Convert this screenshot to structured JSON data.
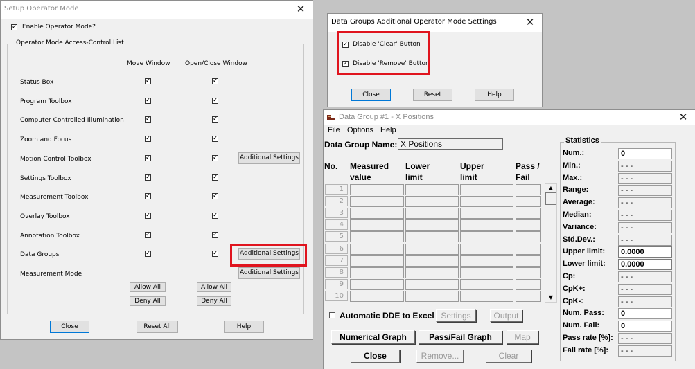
{
  "setup_window": {
    "title": "Setup Operator Mode",
    "enable_label": "Enable Operator Mode?",
    "enable_checked": true,
    "group_label": "Operator Mode Access-Control List",
    "col_move": "Move Window",
    "col_open": "Open/Close Window",
    "rows": [
      {
        "label": "Status Box",
        "move": true,
        "open": true,
        "has_move": true,
        "has_open": true,
        "extra": ""
      },
      {
        "label": "Program Toolbox",
        "move": true,
        "open": true,
        "has_move": true,
        "has_open": true,
        "extra": ""
      },
      {
        "label": "Computer Controlled Illumination",
        "move": true,
        "open": true,
        "has_move": true,
        "has_open": true,
        "extra": ""
      },
      {
        "label": "Zoom and Focus",
        "move": true,
        "open": true,
        "has_move": true,
        "has_open": true,
        "extra": ""
      },
      {
        "label": "Motion Control Toolbox",
        "move": true,
        "open": true,
        "has_move": true,
        "has_open": true,
        "extra": "Additional Settings"
      },
      {
        "label": "Settings Toolbox",
        "move": true,
        "open": true,
        "has_move": true,
        "has_open": true,
        "extra": ""
      },
      {
        "label": "Measurement Toolbox",
        "move": true,
        "open": true,
        "has_move": true,
        "has_open": true,
        "extra": ""
      },
      {
        "label": "Overlay Toolbox",
        "move": true,
        "open": true,
        "has_move": true,
        "has_open": true,
        "extra": ""
      },
      {
        "label": "Annotation Toolbox",
        "move": true,
        "open": true,
        "has_move": true,
        "has_open": true,
        "extra": ""
      },
      {
        "label": "Data Groups",
        "move": true,
        "open": true,
        "has_move": true,
        "has_open": true,
        "extra": "Additional Settings"
      },
      {
        "label": "Measurement Mode",
        "move": false,
        "open": false,
        "has_move": false,
        "has_open": false,
        "extra": "Additional Settings"
      }
    ],
    "allow_all": "Allow All",
    "deny_all": "Deny All",
    "close": "Close",
    "reset_all": "Reset All",
    "help": "Help"
  },
  "dg_settings_window": {
    "title": "Data Groups Additional Operator Mode Settings",
    "disable_clear": "Disable 'Clear' Button",
    "disable_clear_checked": true,
    "disable_remove": "Disable 'Remove' Button",
    "disable_remove_checked": true,
    "close": "Close",
    "reset": "Reset",
    "help": "Help"
  },
  "data_group_window": {
    "title": "Data Group #1 - X Positions",
    "menu": [
      "File",
      "Options",
      "Help"
    ],
    "name_label": "Data Group Name:",
    "name_value": "X Positions",
    "headers": {
      "no": "No.",
      "measured1": "Measured",
      "measured2": "value",
      "lower1": "Lower",
      "lower2": "limit",
      "upper1": "Upper",
      "upper2": "limit",
      "pass1": "Pass /",
      "pass2": "Fail"
    },
    "row_numbers": [
      "1",
      "2",
      "3",
      "4",
      "5",
      "6",
      "7",
      "8",
      "9",
      "10"
    ],
    "dde_label": "Automatic DDE to Excel",
    "dde_checked": false,
    "settings": "Settings",
    "output": "Output",
    "numerical_graph": "Numerical Graph",
    "passfail_graph": "Pass/Fail Graph",
    "map": "Map",
    "close": "Close",
    "remove": "Remove...",
    "clear": "Clear",
    "statistics_label": "Statistics",
    "stats": [
      {
        "label": "Num.:",
        "value": "0",
        "type": "num"
      },
      {
        "label": "Min.:",
        "value": "- - -",
        "type": "ro"
      },
      {
        "label": "Max.:",
        "value": "- - -",
        "type": "ro"
      },
      {
        "label": "Range:",
        "value": "- - -",
        "type": "ro"
      },
      {
        "label": "Average:",
        "value": "- - -",
        "type": "ro"
      },
      {
        "label": "Median:",
        "value": "- - -",
        "type": "ro"
      },
      {
        "label": "Variance:",
        "value": "- - -",
        "type": "ro"
      },
      {
        "label": "Std.Dev.:",
        "value": "- - -",
        "type": "ro"
      },
      {
        "label": "Upper limit:",
        "value": "0.0000",
        "type": "edit"
      },
      {
        "label": "Lower limit:",
        "value": "0.0000",
        "type": "edit"
      },
      {
        "label": "Cp:",
        "value": "- - -",
        "type": "ro"
      },
      {
        "label": "CpK+:",
        "value": "- - -",
        "type": "ro"
      },
      {
        "label": "CpK-:",
        "value": "- - -",
        "type": "ro"
      },
      {
        "label": "Num. Pass:",
        "value": "0",
        "type": "num"
      },
      {
        "label": "Num. Fail:",
        "value": "0",
        "type": "num"
      },
      {
        "label": "Pass rate [%]:",
        "value": "- - -",
        "type": "ro"
      },
      {
        "label": "Fail rate [%]:",
        "value": "- - -",
        "type": "ro"
      }
    ]
  }
}
